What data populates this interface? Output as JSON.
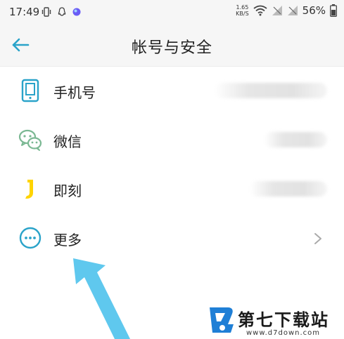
{
  "status_bar": {
    "time": "17:49",
    "net_speed_value": "1.65",
    "net_speed_unit": "KB/S",
    "battery": "56%"
  },
  "header": {
    "title": "帐号与安全"
  },
  "rows": [
    {
      "label": "手机号",
      "icon": "phone-icon"
    },
    {
      "label": "微信",
      "icon": "wechat-icon"
    },
    {
      "label": "即刻",
      "icon": "jike-icon"
    },
    {
      "label": "更多",
      "icon": "more-icon"
    }
  ],
  "watermark": {
    "title": "第七下载站",
    "url": "www.d7down.com"
  },
  "colors": {
    "accent": "#2aa3c9",
    "jike_yellow": "#ffd400",
    "arrow": "#5fc8ee"
  }
}
